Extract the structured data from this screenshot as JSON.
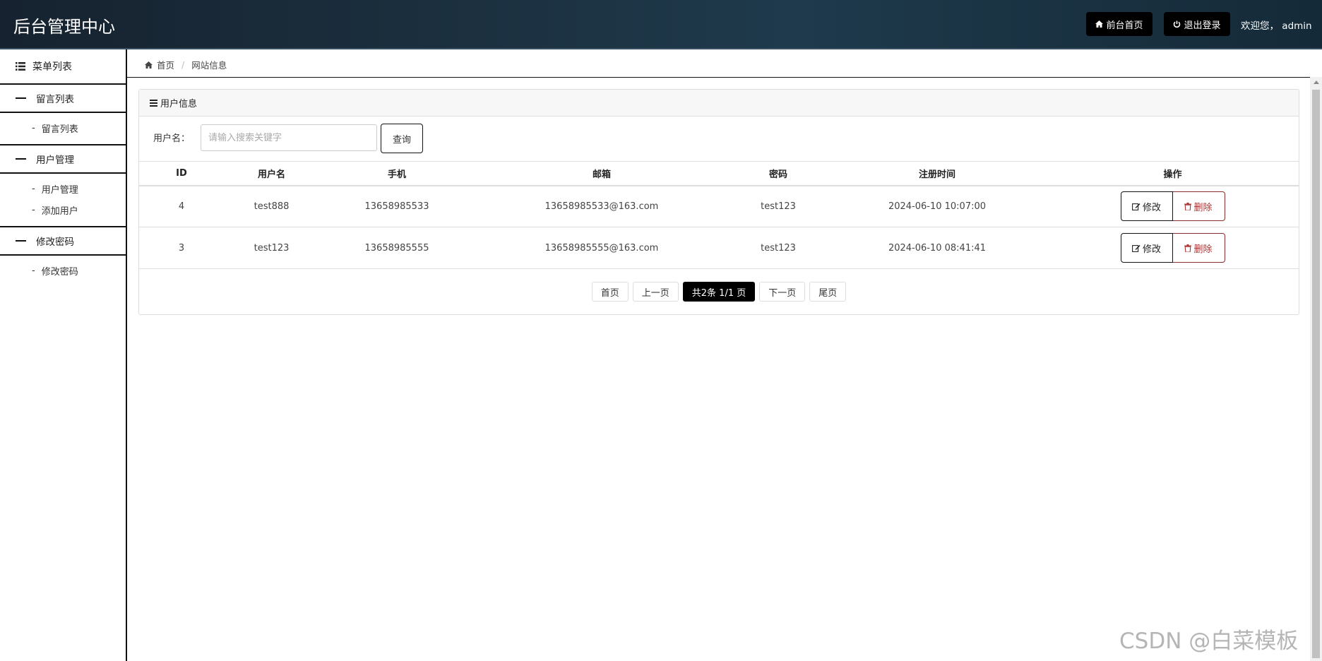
{
  "header": {
    "brand": "后台管理中心",
    "home_label": "前台首页",
    "logout_label": "退出登录",
    "welcome": "欢迎您，  admin"
  },
  "sidebar": {
    "title": "菜单列表",
    "groups": [
      {
        "label": "留言列表",
        "items": [
          "留言列表"
        ]
      },
      {
        "label": "用户管理",
        "items": [
          "用户管理",
          "添加用户"
        ]
      },
      {
        "label": "修改密码",
        "items": [
          "修改密码"
        ]
      }
    ]
  },
  "breadcrumb": {
    "home": "首页",
    "current": "网站信息"
  },
  "panel": {
    "title": "用户信息",
    "search_label": "用户名：",
    "search_placeholder": "请输入搜索关键字",
    "search_button": "查询",
    "columns": [
      "ID",
      "用户名",
      "手机",
      "邮箱",
      "密码",
      "注册时间",
      "操作"
    ],
    "rows": [
      {
        "id": "4",
        "username": "test888",
        "phone": "13658985533",
        "email": "13658985533@163.com",
        "password": "test123",
        "time": "2024-06-10 10:07:00"
      },
      {
        "id": "3",
        "username": "test123",
        "phone": "13658985555",
        "email": "13658985555@163.com",
        "password": "test123",
        "time": "2024-06-10 08:41:41"
      }
    ],
    "edit_label": "修改",
    "delete_label": "删除"
  },
  "pager": {
    "first": "首页",
    "prev": "上一页",
    "summary": "共2条 1/1 页",
    "next": "下一页",
    "last": "尾页"
  },
  "watermark": "CSDN @白菜模板"
}
